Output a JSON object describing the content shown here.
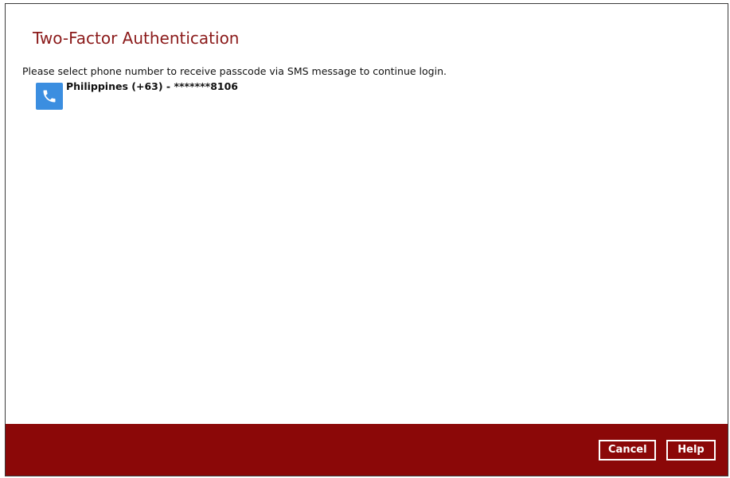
{
  "dialog": {
    "title": "Two-Factor Authentication",
    "instruction": "Please select phone number to receive passcode via SMS message to continue login.",
    "phone_options": [
      {
        "label": "Philippines (+63) - *******8106",
        "icon": "phone-icon"
      }
    ]
  },
  "footer": {
    "cancel_label": "Cancel",
    "help_label": "Help"
  },
  "colors": {
    "title": "#8b1a1a",
    "footer_background": "#8b0808",
    "phone_icon_background": "#3b8ee0"
  }
}
